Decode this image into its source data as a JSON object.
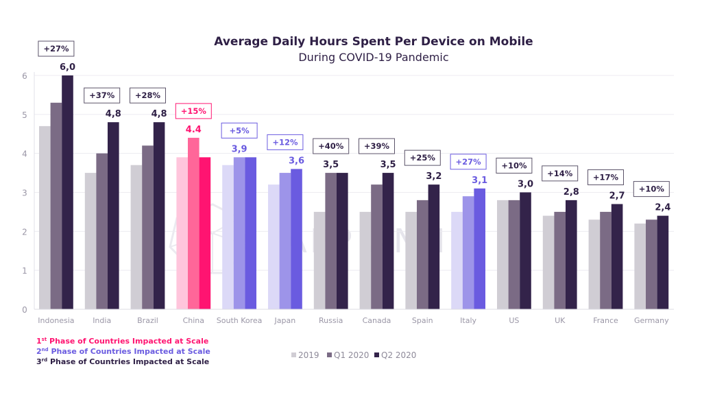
{
  "chart_data": {
    "type": "bar",
    "title": "Average Daily Hours Spent Per Device on Mobile",
    "subtitle": "During COVID-19 Pandemic",
    "xlabel": "",
    "ylabel": "",
    "ylim": [
      0,
      6
    ],
    "yticks": [
      "0",
      "1",
      "2",
      "3",
      "4",
      "5",
      "6"
    ],
    "grid": true,
    "legend_position": "bottom-center",
    "categories": [
      "Indonesia",
      "India",
      "Brazil",
      "China",
      "South Korea",
      "Japan",
      "Russia",
      "Canada",
      "Spain",
      "Italy",
      "US",
      "UK",
      "France",
      "Germany"
    ],
    "series": [
      {
        "name": "2019",
        "values": [
          4.7,
          3.5,
          3.7,
          3.9,
          3.7,
          3.2,
          2.5,
          2.5,
          2.5,
          2.5,
          2.8,
          2.4,
          2.3,
          2.2
        ]
      },
      {
        "name": "Q1 2020",
        "values": [
          5.3,
          4.0,
          4.2,
          4.4,
          3.9,
          3.5,
          3.5,
          3.2,
          2.8,
          2.9,
          2.8,
          2.5,
          2.5,
          2.3
        ]
      },
      {
        "name": "Q2 2020",
        "values": [
          6.0,
          4.8,
          4.8,
          3.9,
          3.9,
          3.6,
          3.5,
          3.5,
          3.2,
          3.1,
          3.0,
          2.8,
          2.7,
          2.4
        ]
      }
    ],
    "value_labels": [
      "6,0",
      "4,8",
      "4,8",
      "4.4",
      "3,9",
      "3,6",
      "3,5",
      "3,5",
      "3,2",
      "3,1",
      "3,0",
      "2,8",
      "2,7",
      "2,4"
    ],
    "growth_labels": [
      "+27%",
      "+37%",
      "+28%",
      "+15%",
      "+5%",
      "+12%",
      "+40%",
      "+39%",
      "+25%",
      "+27%",
      "+10%",
      "+14%",
      "+17%",
      "+10%"
    ],
    "phase": [
      3,
      3,
      3,
      1,
      2,
      2,
      3,
      3,
      3,
      2,
      3,
      3,
      3,
      3
    ],
    "annotations": [
      {
        "ordinal": "1",
        "suffix": "st",
        "text": " Phase of Countries Impacted at Scale",
        "phase": 1
      },
      {
        "ordinal": "2",
        "suffix": "nd",
        "text": " Phase of Countries Impacted at Scale",
        "phase": 2
      },
      {
        "ordinal": "3",
        "suffix": "rd",
        "text": " Phase of Countries Impacted at Scale",
        "phase": 3
      }
    ],
    "watermark": "APP ANNIE"
  },
  "colors": {
    "phase1": [
      "#ffc5dc",
      "#ff6699",
      "#ff1471"
    ],
    "phase2": [
      "#dcd9f7",
      "#9d94e9",
      "#6a5be0"
    ],
    "phase3": [
      "#d0cdd4",
      "#7b6b85",
      "#33234a"
    ],
    "phase1_text": "#ff1471",
    "phase2_text": "#6a5be0",
    "phase3_text": "#2e1f45"
  }
}
